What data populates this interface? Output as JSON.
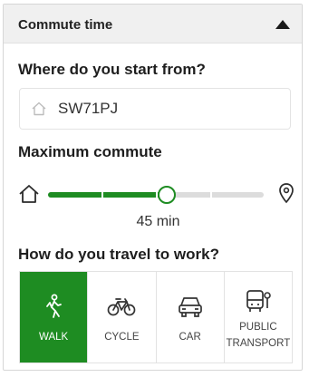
{
  "panel": {
    "title": "Commute time"
  },
  "start": {
    "label": "Where do you start from?",
    "value": "SW71PJ",
    "placeholder": ""
  },
  "commute": {
    "label": "Maximum commute",
    "value_text": "45 min",
    "fraction": 0.55
  },
  "travel": {
    "label": "How do you travel to work?",
    "modes": [
      {
        "label": "WALK",
        "icon": "walk-icon",
        "active": true
      },
      {
        "label": "CYCLE",
        "icon": "bicycle-icon",
        "active": false
      },
      {
        "label": "CAR",
        "icon": "car-icon",
        "active": false
      },
      {
        "label_line1": "PUBLIC",
        "label_line2": "TRANSPORT",
        "icon": "bus-icon",
        "active": false
      }
    ]
  },
  "colors": {
    "accent": "#1e8c22",
    "header_bg": "#f0f0f0",
    "track_bg": "#dcdcdc"
  }
}
